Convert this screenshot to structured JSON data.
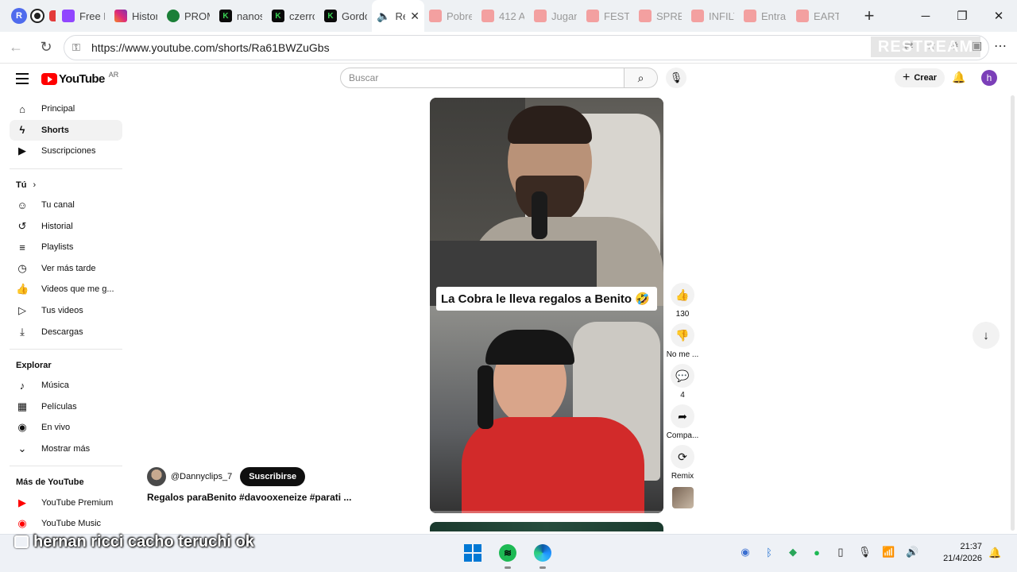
{
  "browser": {
    "pinned": [
      {
        "icon": "r-badge-icon",
        "letter": "R",
        "color": "#4f6bed"
      },
      {
        "icon": "record-icon",
        "letter": "",
        "color": "#222222"
      },
      {
        "icon": "red-dot-icon",
        "letter": "",
        "color": "#e33b3b"
      }
    ],
    "tabs": [
      {
        "icon": "twitch-icon",
        "title": "Free K"
      },
      {
        "icon": "instagram-icon",
        "title": "Histor"
      },
      {
        "icon": "soccer-ball-icon",
        "title": "PROM"
      },
      {
        "icon": "kick-icon",
        "title": "nanos"
      },
      {
        "icon": "kick-icon",
        "title": "czerro"
      },
      {
        "icon": "kick-icon",
        "title": "Gordo"
      },
      {
        "icon": "speaker-icon",
        "title": "Re",
        "active": true
      },
      {
        "icon": "youtube-icon",
        "title": "Pobre"
      },
      {
        "icon": "youtube-icon",
        "title": "412 A"
      },
      {
        "icon": "youtube-icon",
        "title": "Jugan"
      },
      {
        "icon": "youtube-icon",
        "title": "FESTIV"
      },
      {
        "icon": "youtube-icon",
        "title": "SPREI"
      },
      {
        "icon": "youtube-icon",
        "title": "INFILT"
      },
      {
        "icon": "youtube-icon",
        "title": "Entrar"
      },
      {
        "icon": "youtube-icon",
        "title": "EARTH"
      }
    ],
    "url": "https://www.youtube.com/shorts/Ra61BWZuGbs",
    "watermark": "RESTREAM"
  },
  "youtube": {
    "logo_text": "YouTube",
    "country_code": "AR",
    "search_placeholder": "Buscar",
    "create_label": "Crear",
    "avatar_letter": "h",
    "sidebar": {
      "main": [
        {
          "icon": "home-icon",
          "label": "Principal"
        },
        {
          "icon": "shorts-icon",
          "label": "Shorts",
          "selected": true
        },
        {
          "icon": "subscriptions-icon",
          "label": "Suscripciones"
        }
      ],
      "you_header": "Tú",
      "you": [
        {
          "icon": "channel-icon",
          "label": "Tu canal"
        },
        {
          "icon": "history-icon",
          "label": "Historial"
        },
        {
          "icon": "playlists-icon",
          "label": "Playlists"
        },
        {
          "icon": "watch-later-icon",
          "label": "Ver más tarde"
        },
        {
          "icon": "liked-icon",
          "label": "Videos que me g..."
        },
        {
          "icon": "your-videos-icon",
          "label": "Tus videos"
        },
        {
          "icon": "download-icon",
          "label": "Descargas"
        }
      ],
      "explore_header": "Explorar",
      "explore": [
        {
          "icon": "music-icon",
          "label": "Música"
        },
        {
          "icon": "movies-icon",
          "label": "Películas"
        },
        {
          "icon": "live-icon",
          "label": "En vivo"
        },
        {
          "icon": "chevron-down-icon",
          "label": "Mostrar más"
        }
      ],
      "more_header": "Más de YouTube",
      "more": [
        {
          "icon": "youtube-premium-icon",
          "label": "YouTube Premium"
        },
        {
          "icon": "youtube-music-icon",
          "label": "YouTube Music"
        }
      ]
    },
    "short": {
      "caption": "La Cobra le lleva regalos a Benito 🤣",
      "channel": "@Dannyclips_7",
      "subscribe_label": "Suscribirse",
      "title": "Regalos paraBenito #davooxeneize #parati ...",
      "actions": {
        "like_count": "130",
        "dislike_label": "No me ...",
        "comment_count": "4",
        "share_label": "Compa...",
        "remix_label": "Remix"
      }
    }
  },
  "overlay_text": "hernan ricci cacho teruchi ok",
  "taskbar": {
    "time": "21:37",
    "date": "21/4/2026"
  }
}
